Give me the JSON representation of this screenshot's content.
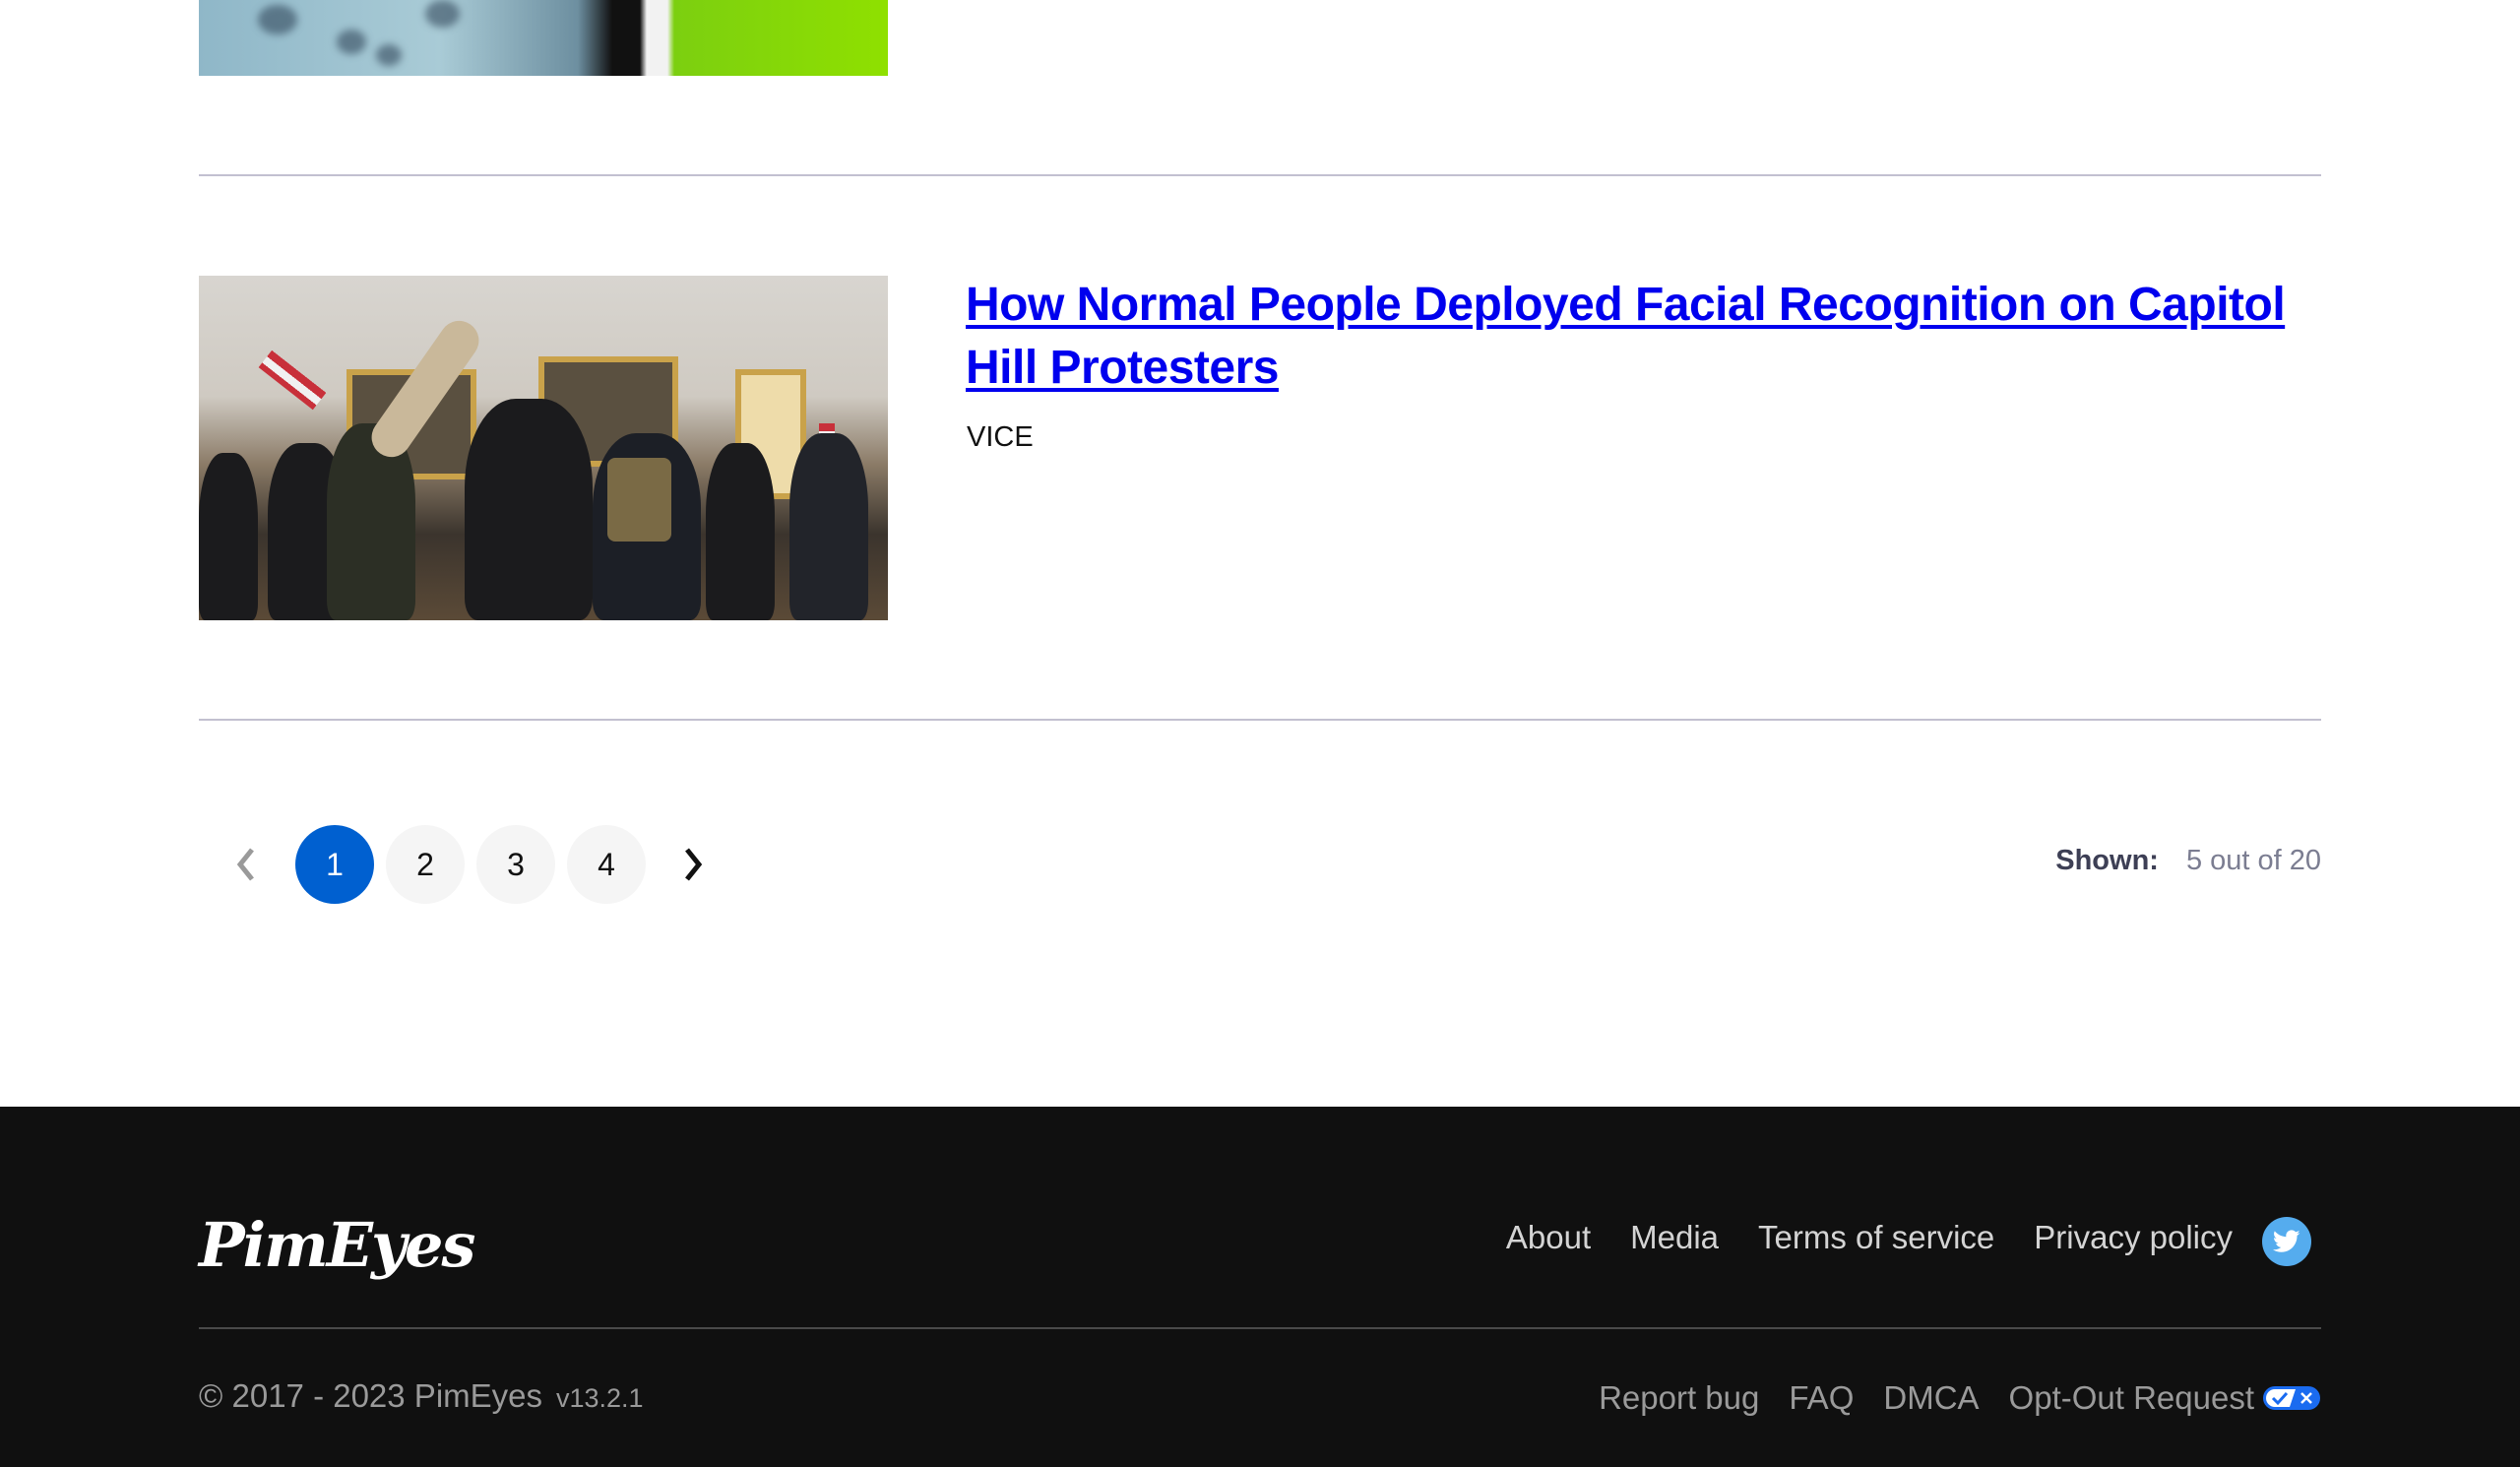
{
  "article": {
    "title": "How Normal People Deployed Facial Recognition on Capitol Hill Protesters",
    "source": "VICE"
  },
  "pagination": {
    "prev_icon": "chevron-left-icon",
    "next_icon": "chevron-right-icon",
    "pages": [
      "1",
      "2",
      "3",
      "4"
    ],
    "current_page": "1",
    "shown_label": "Shown:",
    "shown_value": "5 out of 20"
  },
  "footer": {
    "logo_text": "PimEyes",
    "nav": [
      "About",
      "Media",
      "Terms of service",
      "Privacy policy"
    ],
    "social_icon": "twitter-icon",
    "copyright": "© 2017 - 2023 PimEyes",
    "version": "v13.2.1",
    "links": [
      "Report bug",
      "FAQ",
      "DMCA",
      "Opt-Out Request"
    ],
    "optout_icon": "privacy-choices-icon"
  },
  "colors": {
    "accent": "#0060d0",
    "link": "#0000ee",
    "footer_bg": "#101010",
    "twitter": "#55acee"
  }
}
